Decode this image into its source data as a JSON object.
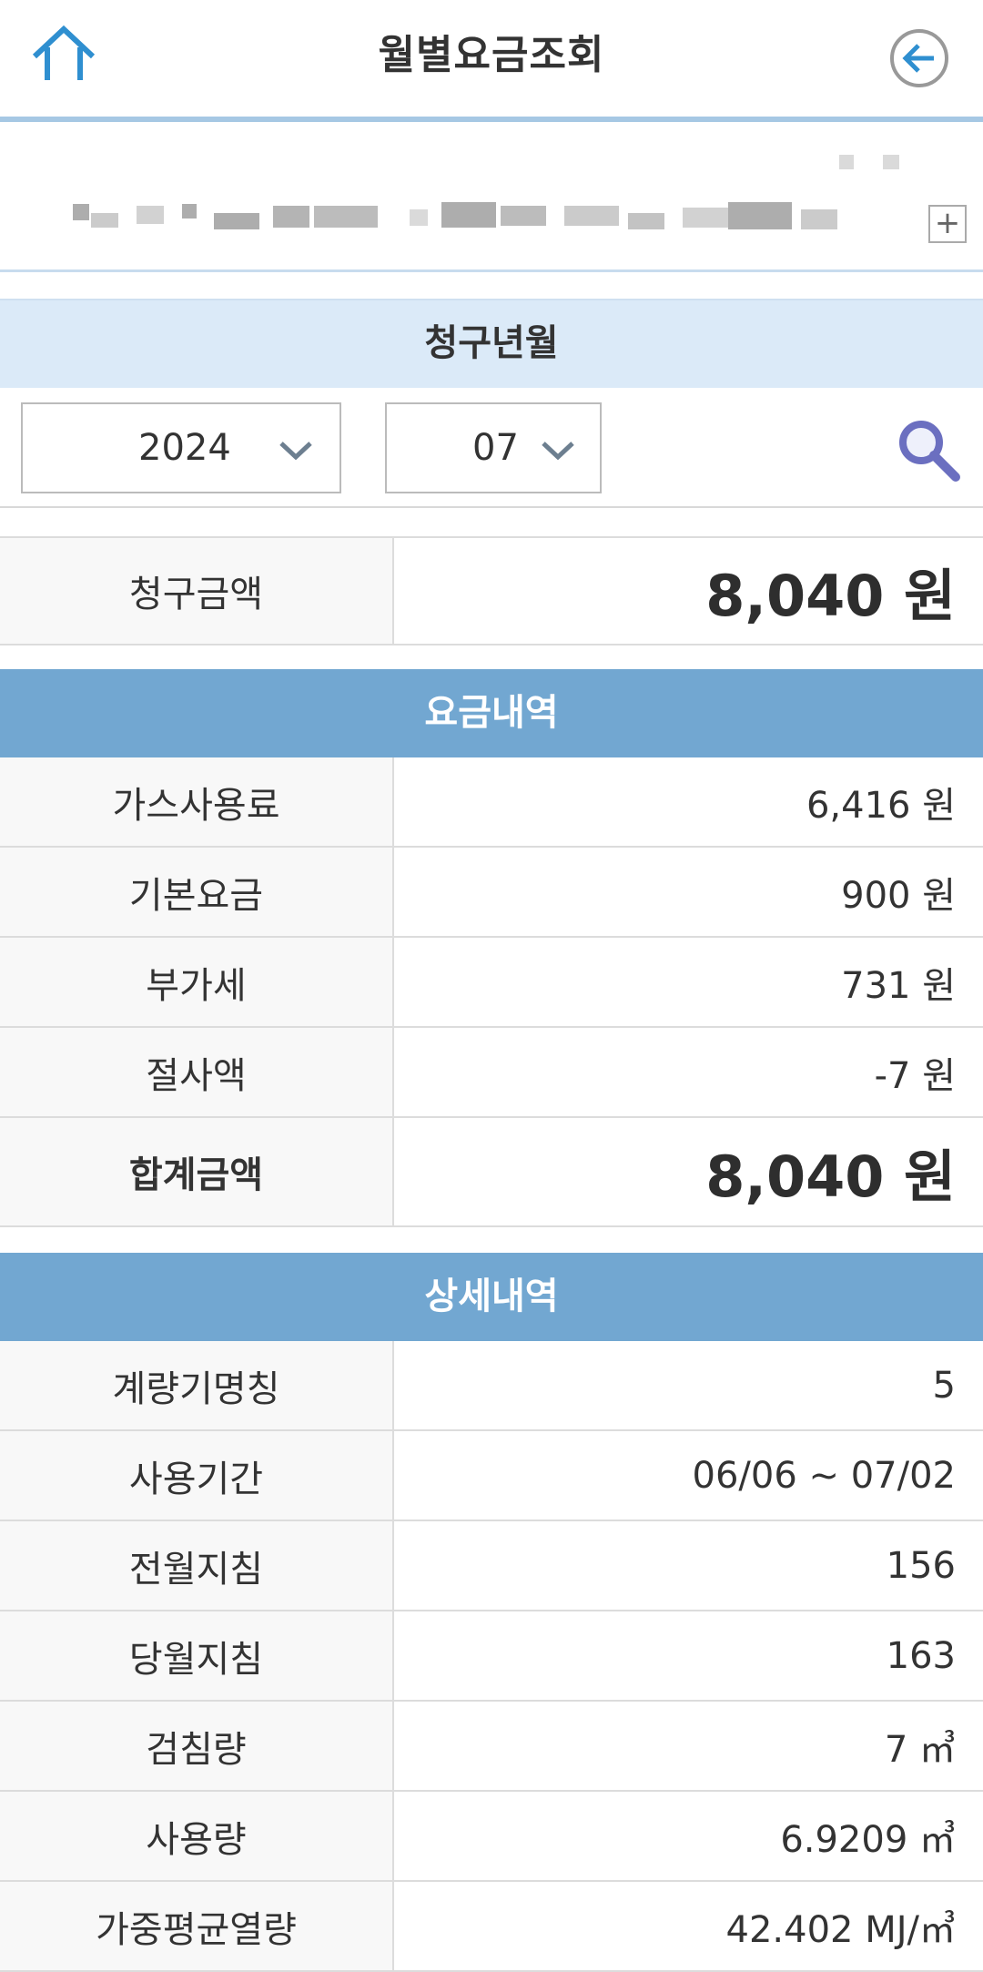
{
  "header": {
    "title": "월별요금조회",
    "home_icon": "home-icon",
    "back_icon": "arrow-left-circle-icon"
  },
  "account": {
    "expand_label": "+"
  },
  "billing_period": {
    "title": "청구년월",
    "year": "2024",
    "month": "07"
  },
  "billed_amount": {
    "label": "청구금액",
    "value": "8,040 원"
  },
  "charges": {
    "title": "요금내역",
    "rows": [
      {
        "label": "가스사용료",
        "value": "6,416 원"
      },
      {
        "label": "기본요금",
        "value": "900 원"
      },
      {
        "label": "부가세",
        "value": "731 원"
      },
      {
        "label": "절사액",
        "value": "-7 원"
      }
    ],
    "total_label": "합계금액",
    "total_value": "8,040 원"
  },
  "details": {
    "title": "상세내역",
    "rows": [
      {
        "label": "계량기명칭",
        "value": "5"
      },
      {
        "label": "사용기간",
        "value": "06/06 ~ 07/02"
      },
      {
        "label": "전월지침",
        "value": "156"
      },
      {
        "label": "당월지침",
        "value": "163"
      },
      {
        "label": "검침량",
        "value": "7 ㎥"
      },
      {
        "label": "사용량",
        "value": "6.9209 ㎥"
      },
      {
        "label": "가중평균열량",
        "value": "42.402 MJ/㎥"
      }
    ]
  },
  "colors": {
    "accent_blue": "#72a7d1",
    "period_bar": "#dbeaf8",
    "icon_blue": "#2f8fd0"
  }
}
